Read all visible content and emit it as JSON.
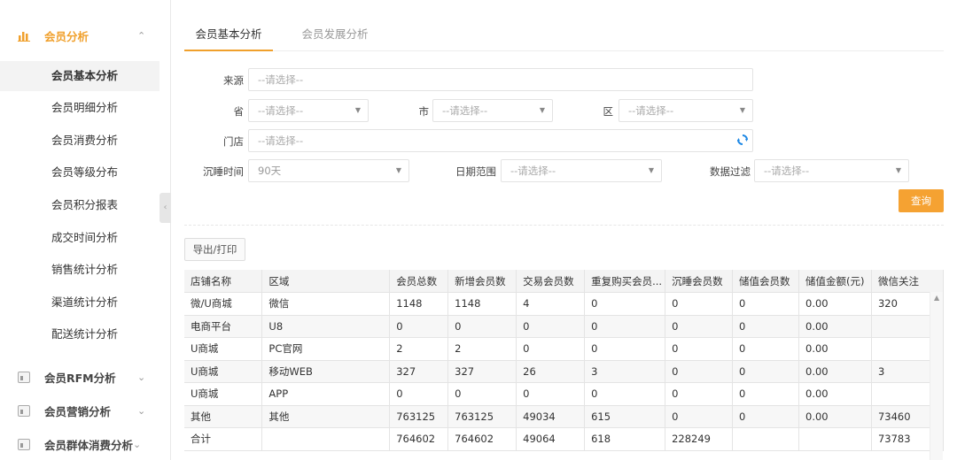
{
  "sidebar": {
    "group_active": {
      "label": "会员分析",
      "chevron": "⌃",
      "icon": "bar-chart-icon"
    },
    "subitems": [
      "会员基本分析",
      "会员明细分析",
      "会员消费分析",
      "会员等级分布",
      "会员积分报表",
      "成交时间分析",
      "销售统计分析",
      "渠道统计分析",
      "配送统计分析"
    ],
    "groups": [
      {
        "label": "会员RFM分析",
        "chevron": "⌄",
        "icon": "report-icon"
      },
      {
        "label": "会员营销分析",
        "chevron": "⌄",
        "icon": "report-icon"
      },
      {
        "label": "会员群体消费分析",
        "chevron": "⌄",
        "icon": "report-icon"
      }
    ],
    "collapse_glyph": "‹"
  },
  "tabs": [
    "会员基本分析",
    "会员发展分析"
  ],
  "filters": {
    "source": {
      "label": "来源",
      "placeholder": "--请选择--"
    },
    "province": {
      "label": "省",
      "placeholder": "--请选择--"
    },
    "city": {
      "label": "市",
      "placeholder": "--请选择--"
    },
    "district": {
      "label": "区",
      "placeholder": "--请选择--"
    },
    "store": {
      "label": "门店",
      "placeholder": "--请选择--"
    },
    "dormant": {
      "label": "沉睡时间",
      "value": "90天"
    },
    "date_range": {
      "label": "日期范围",
      "placeholder": "--请选择--"
    },
    "data_filter": {
      "label": "数据过滤",
      "placeholder": "--请选择--"
    },
    "arrow": "▼"
  },
  "buttons": {
    "query": "查询",
    "export": "导出/打印"
  },
  "table": {
    "headers": [
      "店铺名称",
      "区域",
      "会员总数",
      "新增会员数",
      "交易会员数",
      "重复购买会员...",
      "沉睡会员数",
      "储值会员数",
      "储值金额(元)",
      "微信关注"
    ],
    "rows": [
      [
        "微/U商城",
        "微信",
        "1148",
        "1148",
        "4",
        "0",
        "0",
        "0",
        "0.00",
        "320"
      ],
      [
        "电商平台",
        "U8",
        "0",
        "0",
        "0",
        "0",
        "0",
        "0",
        "0.00",
        ""
      ],
      [
        "U商城",
        "PC官网",
        "2",
        "2",
        "0",
        "0",
        "0",
        "0",
        "0.00",
        ""
      ],
      [
        "U商城",
        "移动WEB",
        "327",
        "327",
        "26",
        "3",
        "0",
        "0",
        "0.00",
        "3"
      ],
      [
        "U商城",
        "APP",
        "0",
        "0",
        "0",
        "0",
        "0",
        "0",
        "0.00",
        ""
      ],
      [
        "其他",
        "其他",
        "763125",
        "763125",
        "49034",
        "615",
        "0",
        "0",
        "0.00",
        "73460"
      ],
      [
        "合计",
        "",
        "764602",
        "764602",
        "49064",
        "618",
        "228249",
        "",
        "",
        "73783"
      ]
    ]
  },
  "colors": {
    "accent": "#f0a02c",
    "query_button": "#f5a232"
  }
}
